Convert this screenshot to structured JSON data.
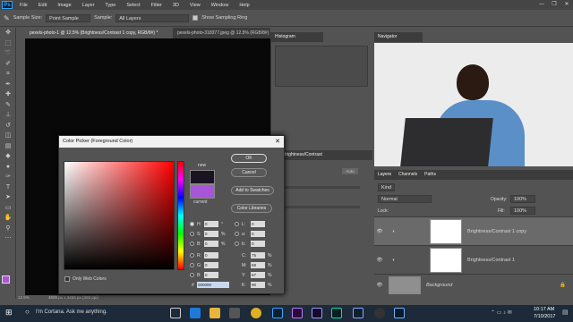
{
  "menu": {
    "logo": "Ps",
    "items": [
      "File",
      "Edit",
      "Image",
      "Layer",
      "Type",
      "Select",
      "Filter",
      "3D",
      "View",
      "Window",
      "Help"
    ],
    "window_controls": [
      "—",
      "❐",
      "✕"
    ]
  },
  "options": {
    "sample_size_label": "Sample Size:",
    "sample_size_value": "Point Sample",
    "sample_label": "Sample:",
    "sample_value": "All Layers",
    "show_ring_label": "Show Sampling Ring",
    "show_ring_checked": true
  },
  "tabs": [
    {
      "label": "pexels-photo-1 @ 12.5% (Brightness/Contrast 1 copy, RGB/8#) *",
      "active": true
    },
    {
      "label": "pexels-photo-318377.jpeg @ 12.5% (RGB/8#)",
      "active": false
    }
  ],
  "status": {
    "zoom": "12.5%",
    "doc": "4608 px x 3456 px (300 ppi)"
  },
  "panels": {
    "histogram": "Histogram",
    "navigator": "Navigator",
    "properties_title": "Brightness/Contrast",
    "auto": "Auto"
  },
  "layers": {
    "tabs": [
      "Layers",
      "Channels",
      "Paths"
    ],
    "kind": "Kind",
    "blend": "Normal",
    "opacity_label": "Opacity:",
    "opacity": "100%",
    "lock_label": "Lock:",
    "fill_label": "Fill:",
    "fill": "100%",
    "rows": [
      {
        "name": "Brightness/Contrast 1 copy",
        "selected": true
      },
      {
        "name": "Brightness/Contrast 1",
        "selected": false
      },
      {
        "name": "Background",
        "selected": false
      }
    ]
  },
  "dialog": {
    "title": "Color Picker (Foreground Color)",
    "ok": "OK",
    "cancel": "Cancel",
    "add_swatches": "Add to Swatches",
    "color_libraries": "Color Libraries",
    "new_label": "new",
    "current_label": "current",
    "only_web": "Only Web Colors",
    "new_color": "#1a1320",
    "current_color": "#a855d8",
    "hsb": [
      {
        "label": "H:",
        "value": "0",
        "unit": "°"
      },
      {
        "label": "S:",
        "value": "0",
        "unit": "%"
      },
      {
        "label": "B:",
        "value": "0",
        "unit": "%"
      }
    ],
    "rgb": [
      {
        "label": "R:",
        "value": "0"
      },
      {
        "label": "G:",
        "value": "0"
      },
      {
        "label": "B:",
        "value": "0"
      }
    ],
    "lab": [
      {
        "label": "L:",
        "value": "0"
      },
      {
        "label": "a:",
        "value": "0"
      },
      {
        "label": "b:",
        "value": "0"
      }
    ],
    "cmyk": [
      {
        "label": "C:",
        "value": "75",
        "unit": "%"
      },
      {
        "label": "M:",
        "value": "68",
        "unit": "%"
      },
      {
        "label": "Y:",
        "value": "67",
        "unit": "%"
      },
      {
        "label": "K:",
        "value": "90",
        "unit": "%"
      }
    ],
    "hex_label": "#",
    "hex": "000000"
  },
  "taskbar": {
    "search": "I'm Cortana. Ask me anything.",
    "time": "10:17 AM",
    "date": "7/10/2017"
  }
}
